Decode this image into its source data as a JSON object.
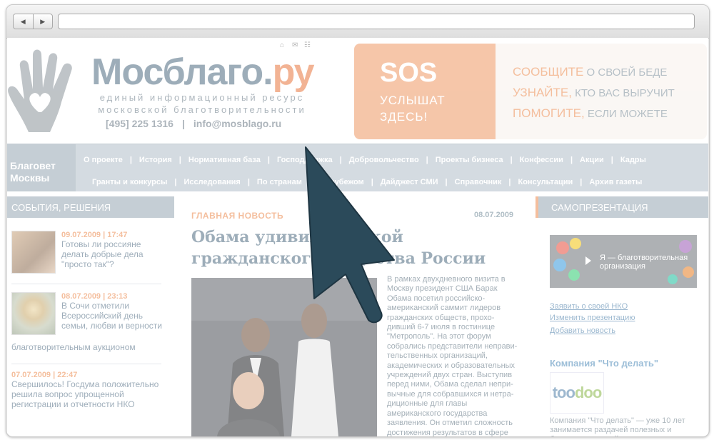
{
  "header": {
    "logo_main": "Мосблаго.",
    "logo_tld": "ру",
    "tagline_1": "единый информационный ресурс",
    "tagline_2": "московской благотворительности",
    "phone": "[495] 225 1316",
    "separator": "|",
    "email": "info@mosblago.ru",
    "icons": [
      "home-icon",
      "mail-icon",
      "sitemap-icon"
    ]
  },
  "sos_banner": {
    "title": "SOS",
    "sub_1": "УСЛЫШАТ",
    "sub_2": "ЗДЕСЬ!",
    "lines": [
      {
        "accent": "СООБЩИТЕ",
        "rest": " О СВОЕЙ БЕДЕ"
      },
      {
        "accent": "УЗНАЙТЕ,",
        "rest": " КТО ВАС ВЫРУЧИТ"
      },
      {
        "accent": "ПОМОГИТЕ,",
        "rest": " ЕСЛИ МОЖЕТЕ"
      }
    ]
  },
  "menu": {
    "brand_1": "Благовет",
    "brand_2": "Москвы",
    "row1": [
      "О проекте",
      "История",
      "Нормативная база",
      "Господдержка",
      "Добровольчество",
      "Проекты бизнеса",
      "Конфессии",
      "Акции",
      "Кадры"
    ],
    "row2": [
      "Гранты и конкурсы",
      "Исследования",
      "По странам",
      "За рубежом",
      "Дайджест СМИ",
      "Справочник",
      "Консультации",
      "Архив газеты"
    ]
  },
  "left": {
    "heading": "СОБЫТИЯ, РЕШЕНИЯ",
    "news": [
      {
        "date": "09.07.2009 | 17:47",
        "text": "Готовы ли россияне делать добрые дела \"просто так\"?"
      },
      {
        "date": "08.07.2009 | 23:13",
        "text": "В Сочи отметили Всероссийский день семьи, любви и верности",
        "text_tail": "благотворительным аукционом"
      },
      {
        "date": "07.07.2009 | 22:47",
        "text": "Свершилось! Госдума положительно решила вопрос упрощенной регистрации и отчетности НКО"
      }
    ]
  },
  "center": {
    "label": "ГЛАВНАЯ НОВОСТЬ",
    "date": "08.07.2009",
    "title": "Обама удивил оценкой гражданского общества России",
    "body": "В рамках двухдневного визита в Москву президент США Барак Обама посетил российско-американский саммит лидеров гражданских обществ, прохо- дивший 6-7 июля в гостинице \"Метрополь\". На этот форум собрались представители неправи- тельственных организаций, академических и образовательных учреждений двух стран. Выступив перед ними, Обама сделал непри- вычные для собравшихся и нетра- диционные для главы американского государства заявления. Он отметил сложность достижения результатов в сфере демократии даже со временем"
  },
  "right": {
    "heading": "САМОПРЕЗЕНТАЦИЯ",
    "video_text": "Я — благотворительная организация",
    "links": [
      "Заявить о своей НКО",
      "Изменить презентацию",
      "Добавить новость"
    ],
    "company_title": "Компания \"Что делать\"",
    "company_logo_a": "too",
    "company_logo_b": "doo",
    "company_desc": "Компания \"Что делать\" — уже 10 лет занимается раздачей полезных и бесплатных вещей нуждающимся"
  },
  "colors": {
    "accent": "#ec8a4e",
    "brand_blue": "#4e6b80",
    "menu_bg": "#b2bfc9",
    "cursor": "#2b4a5a"
  }
}
